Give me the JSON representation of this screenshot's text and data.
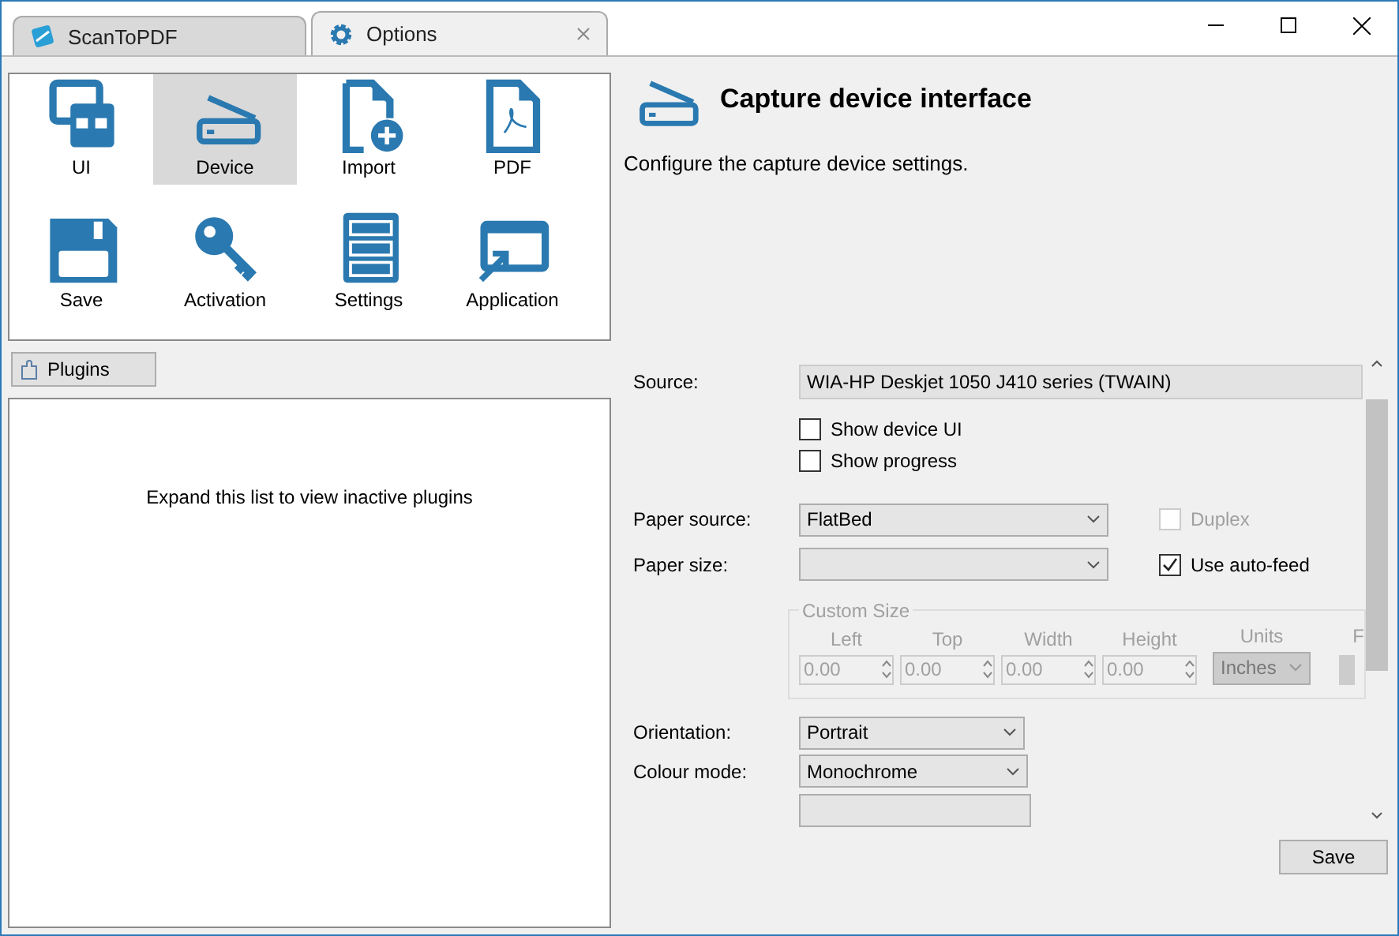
{
  "tabs": [
    {
      "label": "ScanToPDF",
      "selected": false
    },
    {
      "label": "Options",
      "selected": true
    }
  ],
  "options_grid": [
    {
      "label": "UI",
      "selected": false
    },
    {
      "label": "Device",
      "selected": true
    },
    {
      "label": "Import",
      "selected": false
    },
    {
      "label": "PDF",
      "selected": false
    },
    {
      "label": "Save",
      "selected": false
    },
    {
      "label": "Activation",
      "selected": false
    },
    {
      "label": "Settings",
      "selected": false
    },
    {
      "label": "Application",
      "selected": false
    }
  ],
  "plugins_button": "Plugins",
  "plugins_list": {
    "message": "Expand this list to view inactive plugins"
  },
  "header": {
    "title": "Capture device interface",
    "description": "Configure the capture device settings."
  },
  "settings": {
    "source": {
      "label": "Source:",
      "value": "WIA-HP Deskjet 1050 J410 series (TWAIN)"
    },
    "options": [
      {
        "label": "Show device UI",
        "checked": false
      },
      {
        "label": "Show progress",
        "checked": false
      }
    ],
    "paper_source": {
      "label": "Paper source:",
      "value": "FlatBed",
      "side": {
        "label": "Duplex",
        "checked": false,
        "disabled": true
      }
    },
    "paper_size": {
      "label": "Paper size:",
      "side": {
        "label": "Use auto-feed",
        "checked": true,
        "disabled": false
      }
    },
    "custom_size": {
      "title": "Custom Size",
      "disabled": true,
      "fields": [
        {
          "label": "Left",
          "value": "0.00"
        },
        {
          "label": "Top",
          "value": "0.00"
        },
        {
          "label": "Width",
          "value": "0.00"
        },
        {
          "label": "Height",
          "value": "0.00"
        }
      ],
      "units": {
        "label": "Units",
        "value": "Inches"
      },
      "cut_label": "F"
    },
    "selects": [
      {
        "label": "Orientation:",
        "value": "Portrait"
      },
      {
        "label": "Colour mode:",
        "value": "Monochrome"
      }
    ]
  },
  "save_button": "Save"
}
